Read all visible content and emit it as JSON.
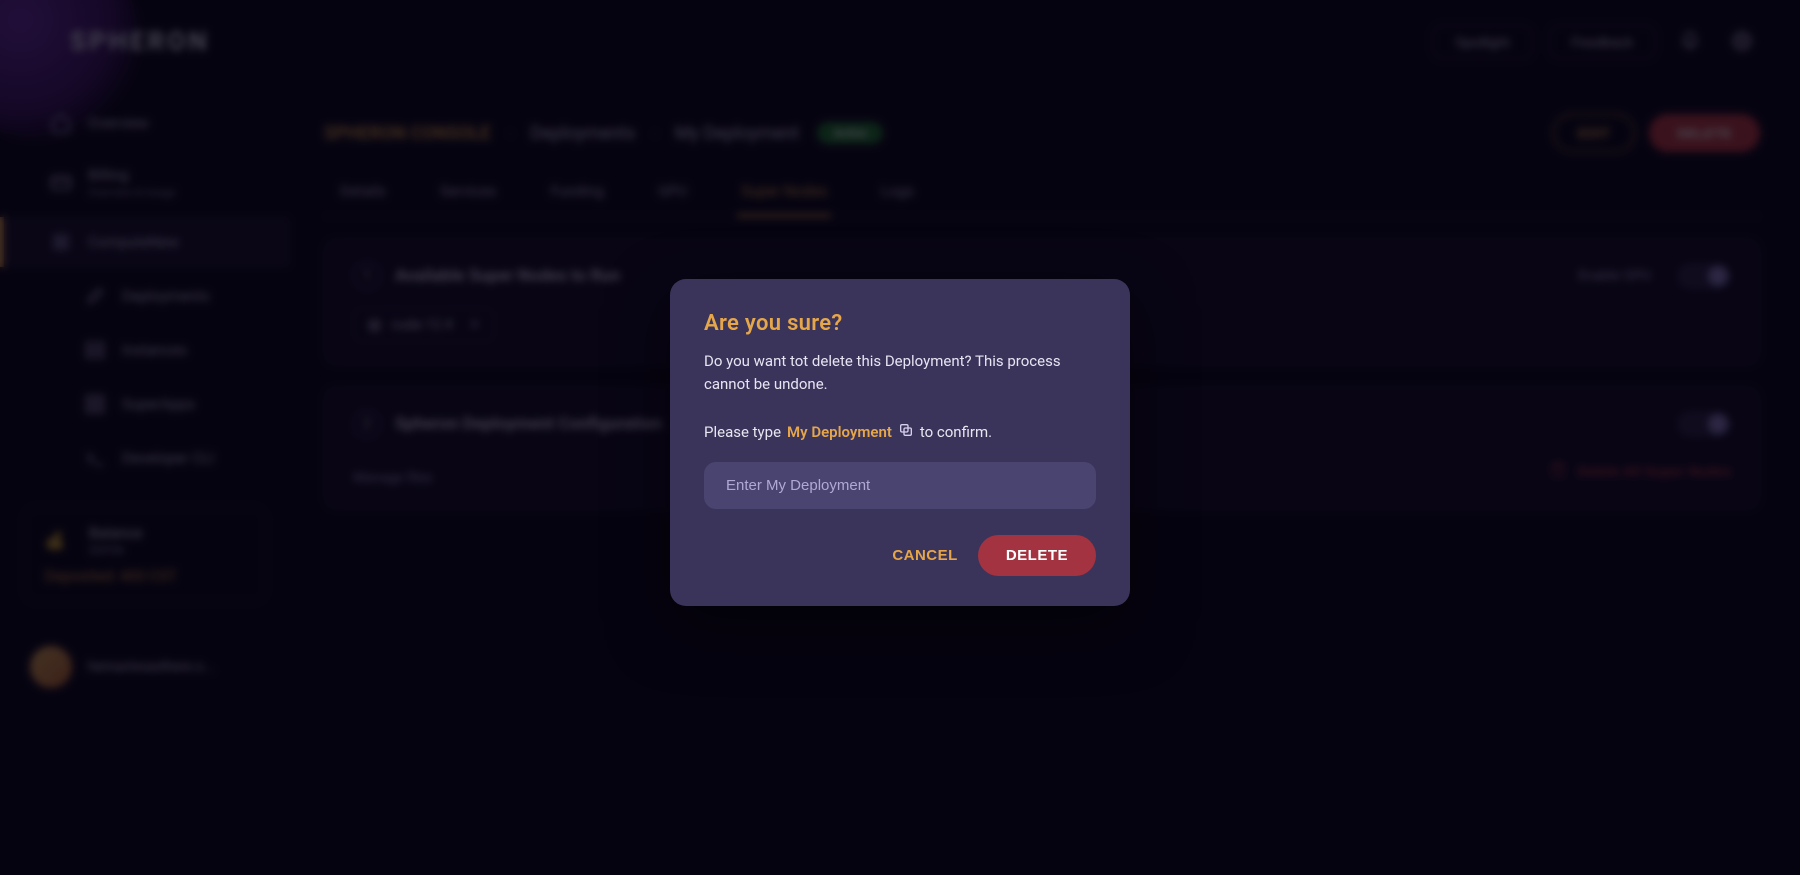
{
  "brand": "SPHERON",
  "topbar": {
    "action1": "Spotlight",
    "action2": "Feedback"
  },
  "sidebar": {
    "items": [
      {
        "label": "Overview"
      },
      {
        "label": "Billing",
        "sublabel": "Overview & Usage"
      },
      {
        "label": "ComputeNew"
      },
      {
        "label": "Deployments"
      },
      {
        "label": "Instances"
      },
      {
        "label": "SuperApps"
      },
      {
        "label": "Developer CLI"
      }
    ]
  },
  "balance": {
    "title": "Balance",
    "currency": "$SPON",
    "amount": "Deposited: 400 CST"
  },
  "user": {
    "name": "hemantwasthere.s..."
  },
  "breadcrumb": {
    "project": "SPHERON CONSOLE",
    "section": "Deployments",
    "item": "My Deployment",
    "status": "Active"
  },
  "header_actions": {
    "edit": "EDIT",
    "delete": "DELETE"
  },
  "tabs": [
    "Details",
    "Services",
    "Funding",
    "GPU",
    "Super Nodes",
    "Logs"
  ],
  "active_tab": "Super Nodes",
  "cards": [
    {
      "num": "1",
      "title": "Available Super Nodes to Run",
      "tag": "cuda  12.4",
      "toggle_label": "Enable GPU"
    },
    {
      "num": "2",
      "title": "Spheron Deployment Configuration",
      "subtitle": "Manage files",
      "danger_action": "Delete All Super Nodes"
    }
  ],
  "modal": {
    "title": "Are you sure?",
    "body": "Do you want tot delete this Deployment? This process cannot be undone.",
    "confirm_prefix": "Please type",
    "keyword": "My Deployment",
    "confirm_suffix": "to confirm.",
    "placeholder": "Enter My Deployment",
    "cancel": "CANCEL",
    "delete": "DELETE"
  }
}
